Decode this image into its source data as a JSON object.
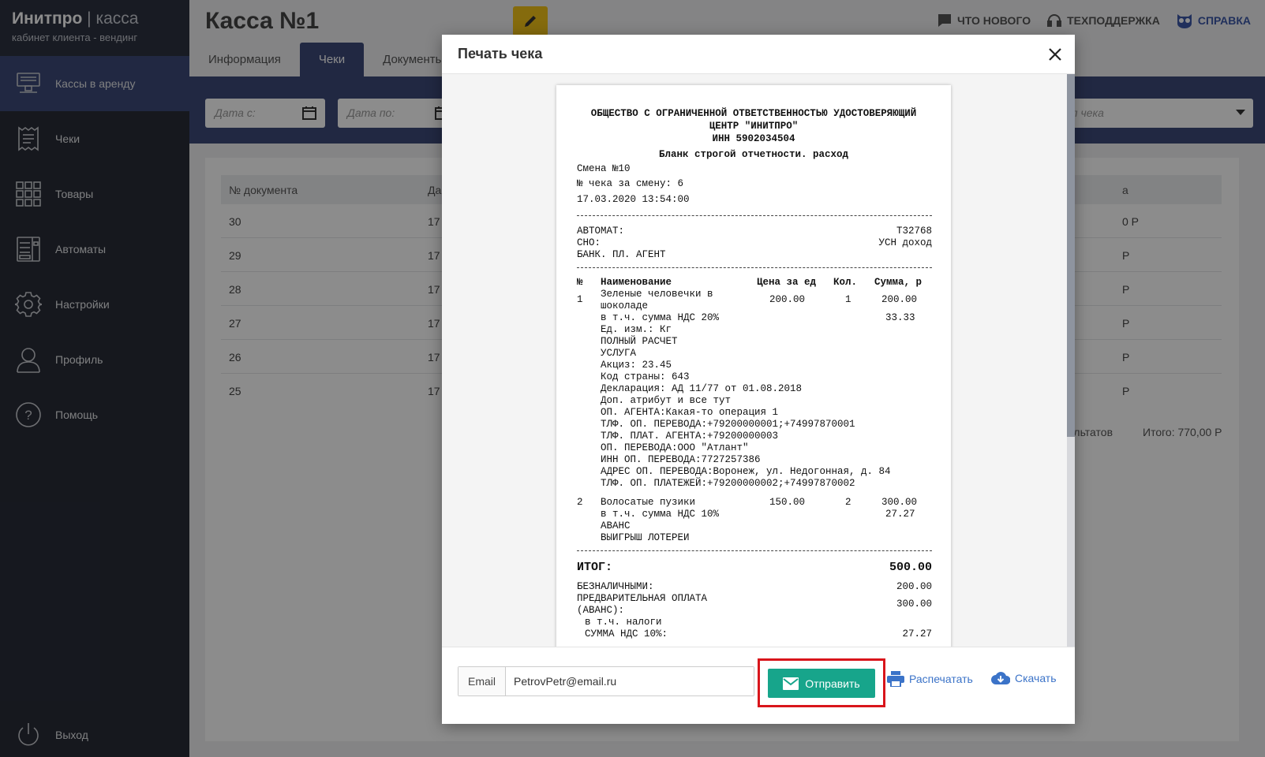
{
  "brand": {
    "name": "Инитпро",
    "sep": "|",
    "product": "касса",
    "subtitle": "кабинет клиента - вендинг"
  },
  "sidebar": {
    "items": [
      {
        "label": "Кассы в аренду",
        "icon": "cash-register-icon",
        "active": true
      },
      {
        "label": "Чеки",
        "icon": "receipt-icon"
      },
      {
        "label": "Товары",
        "icon": "grid-icon"
      },
      {
        "label": "Автоматы",
        "icon": "vending-machine-icon"
      },
      {
        "label": "Настройки",
        "icon": "gear-icon"
      },
      {
        "label": "Профиль",
        "icon": "user-icon"
      },
      {
        "label": "Помощь",
        "icon": "help-icon"
      }
    ],
    "logout": "Выход"
  },
  "header": {
    "title": "Касса №1",
    "links": {
      "news": "ЧТО НОВОГО",
      "support": "ТЕХПОДДЕРЖКА",
      "help": "СПРАВКА"
    },
    "tabs": [
      "Информация",
      "Чеки",
      "Документы"
    ]
  },
  "filters": {
    "date_from": "Дата с:",
    "date_to": "Дата по:",
    "type": "Тип чека"
  },
  "table": {
    "col_doc": "№ документа",
    "col_date": "Да",
    "col_sum": "а",
    "rows": [
      {
        "doc": "30",
        "date": "17",
        "sum": "0 Р"
      },
      {
        "doc": "29",
        "date": "17",
        "sum": "Р"
      },
      {
        "doc": "28",
        "date": "17",
        "sum": "Р"
      },
      {
        "doc": "27",
        "date": "17",
        "sum": "Р"
      },
      {
        "doc": "26",
        "date": "17",
        "sum": "Р"
      },
      {
        "doc": "25",
        "date": "17",
        "sum": "Р"
      }
    ],
    "results": "езультатов",
    "total": "Итого: 770,00 Р"
  },
  "modal": {
    "title": "Печать чека",
    "email_label": "Email",
    "email_value": "PetrovPetr@email.ru",
    "send": "Отправить",
    "print": "Распечатать",
    "download": "Скачать"
  },
  "receipt": {
    "org_line1": "ОБЩЕСТВО С ОГРАНИЧЕННОЙ ОТВЕТСТВЕННОСТЬЮ УДОСТОВЕРЯЮЩИЙ",
    "org_line2": "ЦЕНТР \"ИНИТПРО\"",
    "inn": "ИНН 5902034504",
    "doc_type": "Бланк строгой отчетности. расход",
    "shift": "Смена №10",
    "check_no": "№ чека за смену: 6",
    "datetime": "17.03.2020 13:54:00",
    "automat_label": "АВТОМАТ:",
    "automat_value": "Т32768",
    "sno_label": "СНО:",
    "sno_value": "УСН доход",
    "agent": "БАНК. ПЛ. АГЕНТ",
    "cols": {
      "num": "№",
      "name": "Наименование",
      "price": "Цена за ед",
      "qty": "Кол.",
      "sum": "Сумма, р"
    },
    "item1": {
      "num": "1",
      "name1": "Зеленые человечки в",
      "name2": "шоколаде",
      "price": "200.00",
      "qty": "1",
      "sum": "200.00",
      "vat_label": "в т.ч. сумма НДС 20%",
      "vat": "33.33",
      "details": [
        "Ед. изм.: Кг",
        "ПОЛНЫЙ РАСЧЕТ",
        "УСЛУГА",
        "Акциз: 23.45",
        "Код страны: 643",
        "Декларация: АД 11/77 от 01.08.2018",
        "Доп. атрибут и все тут",
        "ОП. АГЕНТА:Какая-то операция 1",
        "ТЛФ. ОП. ПЕРЕВОДА:+79200000001;+74997870001",
        "ТЛФ. ПЛАТ. АГЕНТА:+79200000003",
        "ОП. ПЕРЕВОДА:ООО \"Атлант\"",
        "ИНН ОП. ПЕРЕВОДА:7727257386",
        "АДРЕС ОП. ПЕРЕВОДА:Воронеж, ул. Недогонная, д. 84",
        "ТЛФ. ОП. ПЛАТЕЖЕЙ:+79200000002;+74997870002"
      ]
    },
    "item2": {
      "num": "2",
      "name": "Волосатые пузики",
      "price": "150.00",
      "qty": "2",
      "sum": "300.00",
      "vat_label": "в т.ч. сумма НДС 10%",
      "vat": "27.27",
      "details": [
        "АВАНС",
        "ВЫИГРЫШ ЛОТЕРЕИ"
      ]
    },
    "total_label": "ИТОГ:",
    "total": "500.00",
    "cashless_label": "БЕЗНАЛИЧНЫМИ:",
    "cashless": "200.00",
    "prepay_label1": "ПРЕДВАРИТЕЛЬНАЯ ОПЛАТА",
    "prepay_label2": "(АВАНС):",
    "prepay": "300.00",
    "taxes_label": "в т.ч. налоги",
    "vat10_label": "СУММА НДС 10%:",
    "vat10": "27.27"
  },
  "colors": {
    "sidebar": "#282c38",
    "accent": "#3d4a78",
    "edit": "#f2c418",
    "send": "#17a58b",
    "highlight": "#d9151b",
    "link": "#3b73c8"
  }
}
